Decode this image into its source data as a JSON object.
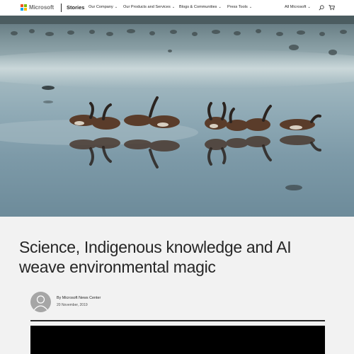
{
  "header": {
    "brand": "Microsoft",
    "section": "Stories",
    "nav": [
      {
        "label": "Our Company"
      },
      {
        "label": "Our Products and Services"
      },
      {
        "label": "Blogs & Communities"
      },
      {
        "label": "Press Tools"
      }
    ],
    "all_microsoft": "All Microsoft",
    "logo_colors": [
      "#f25022",
      "#7fba00",
      "#00a4ef",
      "#ffb900"
    ]
  },
  "hero": {
    "icon": "photo-of-whistling-ducks-on-water"
  },
  "article": {
    "title_line1": "Science, Indigenous knowledge and AI",
    "title_line2": "weave environmental magic",
    "byline": "By Microsoft News Center",
    "date": "20 November, 2019"
  }
}
